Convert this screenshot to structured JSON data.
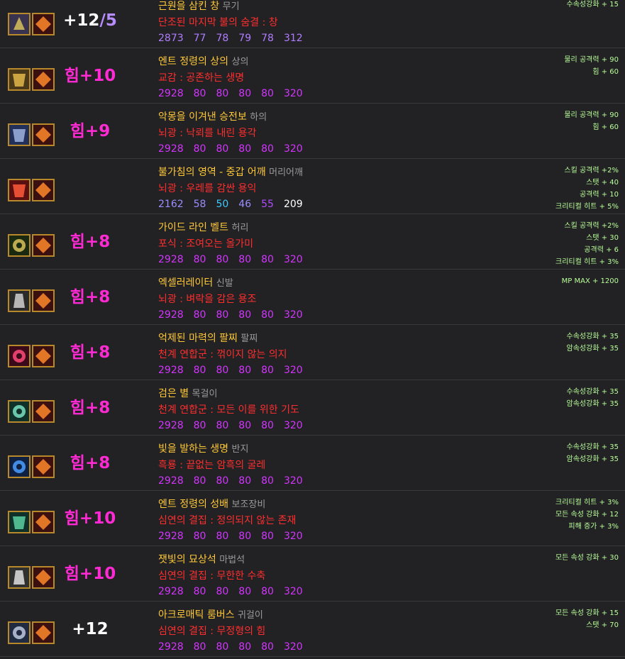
{
  "colors": {
    "background": "#222224",
    "item_name": "#ffc838",
    "set_name": "#ff2e2e",
    "enhance": "#ff2ad4",
    "stat": "#b9ff9a",
    "numbers": "#d335ff"
  },
  "items": [
    {
      "enhance_text": "+12",
      "enhance_suffix": "/5",
      "name": "근원을 삼킨 창",
      "slot": "무기",
      "set_option": "단조된 마지막 불의 숨결 : 창",
      "numbers": [
        "2873",
        "77",
        "78",
        "79",
        "78",
        "312"
      ],
      "stats": [
        "수속성강화 + 15"
      ],
      "icons": [
        "weapon-spear-icon",
        "emblem-icon"
      ]
    },
    {
      "enhance_text": "힘+10",
      "name": "엔트 정령의 상의",
      "slot": "상의",
      "set_option": "교감 : 공존하는 생명",
      "numbers": [
        "2928",
        "80",
        "80",
        "80",
        "80",
        "320"
      ],
      "stats": [
        "물리 공격력 + 90",
        "힘 + 60"
      ],
      "icons": [
        "armor-top-icon",
        "emblem-icon"
      ]
    },
    {
      "enhance_text": "힘+9",
      "name": "악몽을 이겨낸 승전보",
      "slot": "하의",
      "set_option": "뇌광 : 낙뢰를 내린 용각",
      "numbers": [
        "2928",
        "80",
        "80",
        "80",
        "80",
        "320"
      ],
      "stats": [
        "물리 공격력 + 90",
        "힘 + 60"
      ],
      "icons": [
        "armor-pants-icon",
        "emblem-icon"
      ]
    },
    {
      "enhance_text": "",
      "name": "불가침의 영역 - 중갑 어깨",
      "slot": "머리어깨",
      "set_option": "뇌광 : 우레를 감싼 용익",
      "numbers": [
        "2162",
        "58",
        "50",
        "46",
        "55",
        "209"
      ],
      "stats": [
        "스킬 공격력 +2%",
        "스탯 + 40",
        "공격력 + 10",
        "크리티컬 히트 + 5%"
      ],
      "icons": [
        "shoulder-armor-icon",
        "emblem-icon"
      ]
    },
    {
      "enhance_text": "힘+8",
      "name": "가이드 라인 벨트",
      "slot": "허리",
      "set_option": "포식 : 조여오는 올가미",
      "numbers": [
        "2928",
        "80",
        "80",
        "80",
        "80",
        "320"
      ],
      "stats": [
        "스킬 공격력 +2%",
        "스탯 + 30",
        "공격력 + 6",
        "크리티컬 히트 + 3%"
      ],
      "icons": [
        "belt-icon",
        "emblem-icon"
      ]
    },
    {
      "enhance_text": "힘+8",
      "name": "엑셀러레이터",
      "slot": "신발",
      "set_option": "뇌광 : 벼락을 감은 용조",
      "numbers": [
        "2928",
        "80",
        "80",
        "80",
        "80",
        "320"
      ],
      "stats": [
        "MP MAX + 1200"
      ],
      "icons": [
        "boots-icon",
        "emblem-icon"
      ]
    },
    {
      "enhance_text": "힘+8",
      "name": "억제된 마력의 팔찌",
      "slot": "팔찌",
      "set_option": "천계 연합군 : 꺾이지 않는 의지",
      "numbers": [
        "2928",
        "80",
        "80",
        "80",
        "80",
        "320"
      ],
      "stats": [
        "수속성강화 + 35",
        "암속성강화 + 35"
      ],
      "icons": [
        "bracelet-icon",
        "emblem-icon"
      ]
    },
    {
      "enhance_text": "힘+8",
      "name": "검은 별",
      "slot": "목걸이",
      "set_option": "천계 연합군 : 모든 이를 위한 기도",
      "numbers": [
        "2928",
        "80",
        "80",
        "80",
        "80",
        "320"
      ],
      "stats": [
        "수속성강화 + 35",
        "암속성강화 + 35"
      ],
      "icons": [
        "necklace-icon",
        "emblem-icon"
      ]
    },
    {
      "enhance_text": "힘+8",
      "name": "빛을 발하는 생명",
      "slot": "반지",
      "set_option": "흑룡 : 끝없는 암흑의 굴레",
      "numbers": [
        "2928",
        "80",
        "80",
        "80",
        "80",
        "320"
      ],
      "stats": [
        "수속성강화 + 35",
        "암속성강화 + 35"
      ],
      "icons": [
        "ring-icon",
        "emblem-icon"
      ]
    },
    {
      "enhance_text": "힘+10",
      "name": "엔트 정령의 성배",
      "slot": "보조장비",
      "set_option": "심연의 결집 : 정의되지 않는 존재",
      "numbers": [
        "2928",
        "80",
        "80",
        "80",
        "80",
        "320"
      ],
      "stats": [
        "크리티컬 히트 + 3%",
        "모든 속성 강화 + 12",
        "피해 증가 + 3%"
      ],
      "icons": [
        "chalice-icon",
        "emblem-icon"
      ]
    },
    {
      "enhance_text": "힘+10",
      "name": "잿빛의 묘상석",
      "slot": "마법석",
      "set_option": "심연의 결집 : 무한한 수축",
      "numbers": [
        "2928",
        "80",
        "80",
        "80",
        "80",
        "320"
      ],
      "stats": [
        "모든 속성 강화 + 30"
      ],
      "icons": [
        "magic-stone-icon",
        "emblem-icon"
      ]
    },
    {
      "enhance_text": "+12",
      "name": "아크로매틱 룸버스",
      "slot": "귀걸이",
      "set_option": "심연의 결집 : 무정형의 힘",
      "numbers": [
        "2928",
        "80",
        "80",
        "80",
        "80",
        "320"
      ],
      "stats": [
        "모든 속성 강화 + 15",
        "스탯 + 70"
      ],
      "icons": [
        "earring-icon",
        "emblem-icon"
      ]
    }
  ]
}
